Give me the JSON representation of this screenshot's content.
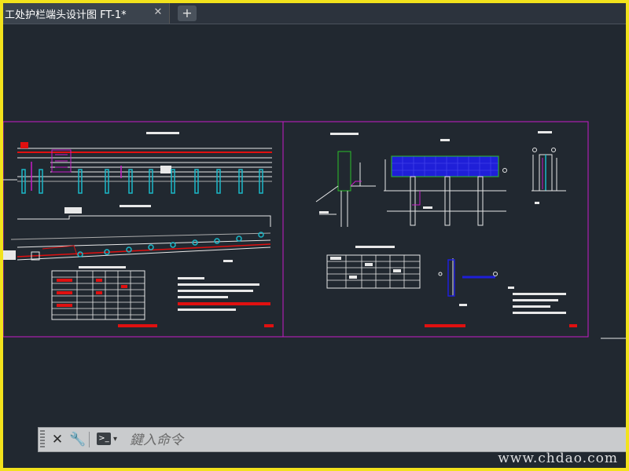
{
  "tabs": [
    {
      "label": "工处护栏端头设计图 FT-1*",
      "close_icon": "close-icon",
      "active": true
    }
  ],
  "new_tab_label": "+",
  "command": {
    "placeholder": "鍵入命令",
    "close_label": "✕",
    "customize_icon": "wrench-icon",
    "prompt_icon": "command-prompt-icon",
    "prompt_glyph": ">_",
    "caret": "▾"
  },
  "watermark": "www.chdao.com",
  "colors": {
    "background": "#212830",
    "outer_border": "#f2e21c",
    "sheet_border": "#c71cc7",
    "accent_red": "#e01010",
    "hatch_blue": "#1f1fd8",
    "post_cyan": "#1ab8c8",
    "line_white": "#e8e8e8",
    "line_green": "#2ac02a"
  }
}
